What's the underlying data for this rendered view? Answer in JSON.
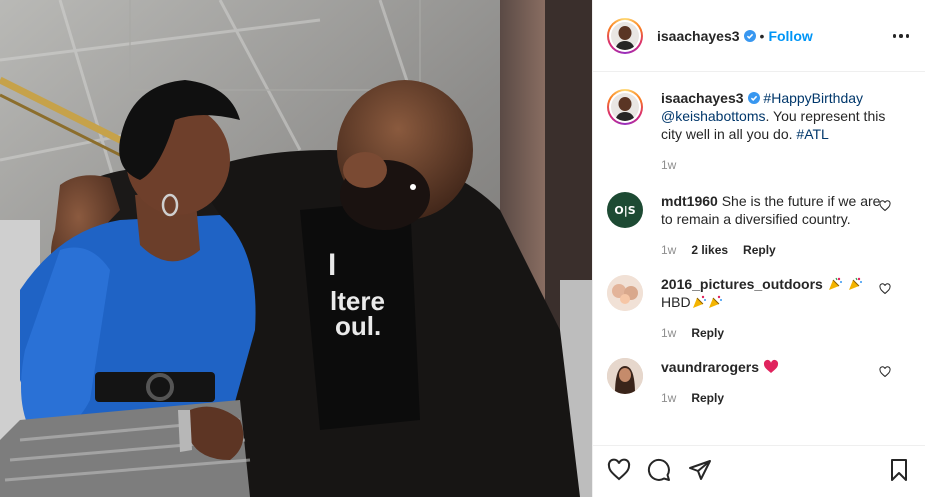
{
  "post": {
    "author": "isaachayes3",
    "follow_label": "Follow",
    "separator": "•",
    "caption": {
      "author": "isaachayes3",
      "hashtag1": "#HappyBirthday",
      "mention": "@keishabottoms",
      "text": ". You represent this city well in all you do.",
      "hashtag2": "#ATL",
      "time": "1w"
    }
  },
  "comments": [
    {
      "user": "mdt1960",
      "text": "She is the future if we are to remain a diversified country.",
      "time": "1w",
      "likes": "2 likes",
      "reply": "Reply"
    },
    {
      "user": "2016_pictures_outdoors",
      "text": "HBD",
      "time": "1w",
      "reply": "Reply"
    },
    {
      "user": "vaundrarogers",
      "text": "",
      "time": "1w",
      "reply": "Reply"
    }
  ],
  "icons": {
    "verified": "verified-badge-icon",
    "more": "more-options-icon",
    "like": "heart-icon",
    "comment": "comment-icon",
    "share": "paper-plane-icon",
    "save": "bookmark-icon"
  },
  "colors": {
    "link": "#00376b",
    "follow": "#0095f6",
    "muted": "#8e8e8e",
    "verified": "#3897f0",
    "heart_emoji": "#e0245e"
  }
}
